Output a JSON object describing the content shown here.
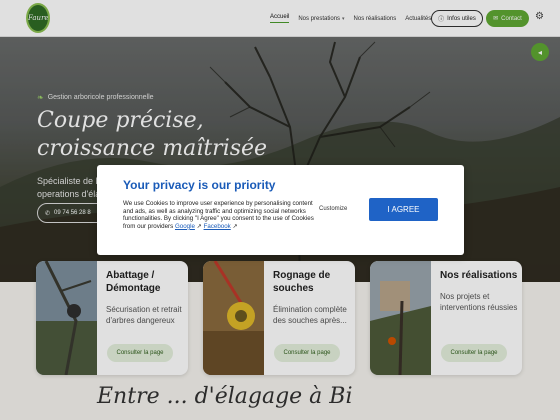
{
  "header": {
    "logo_text": "Faure",
    "nav": [
      {
        "label": "Accueil",
        "active": true
      },
      {
        "label": "Nos prestations",
        "dropdown": true
      },
      {
        "label": "Nos réalisations"
      },
      {
        "label": "Actualités"
      }
    ],
    "info_button": "Infos utiles",
    "contact_button": "Contact"
  },
  "hero": {
    "kicker": "Gestion arboricole professionnelle",
    "title_line1": "Coupe précise,",
    "title_line2": "croissance maîtrisée",
    "subtitle_line1": "Spécialiste de l'",
    "subtitle_line2": "operations d'éla",
    "phone": "09 74 56 28 8"
  },
  "cards": [
    {
      "title": "Abattage / Démontage",
      "desc": "Sécurisation et retrait d'arbres dangereux",
      "button": "Consulter la page"
    },
    {
      "title": "Rognage de souches",
      "desc": "Élimination complète des souches après...",
      "button": "Consulter la page"
    },
    {
      "title": "Nos réalisations",
      "desc": "Nos projets et interventions réussies",
      "button": "Consulter la page"
    }
  ],
  "bottom_heading": "Entre ... d'élagage à Bi",
  "cookie": {
    "title": "Your privacy is our priority",
    "text": "We use Cookies to improve user experience by personalising content and ads, as well as analyzing traffic and optimizing social networks functionalities. By clicking \"I Agree\" you consent to the use of Cookies from our providers",
    "link_google": "Google",
    "link_facebook": "Facebook",
    "customize": "Customize",
    "agree": "I AGREE"
  },
  "colors": {
    "accent_green": "#5fa833",
    "cookie_blue": "#1f63c6",
    "title_blue": "#1a5bb8"
  }
}
